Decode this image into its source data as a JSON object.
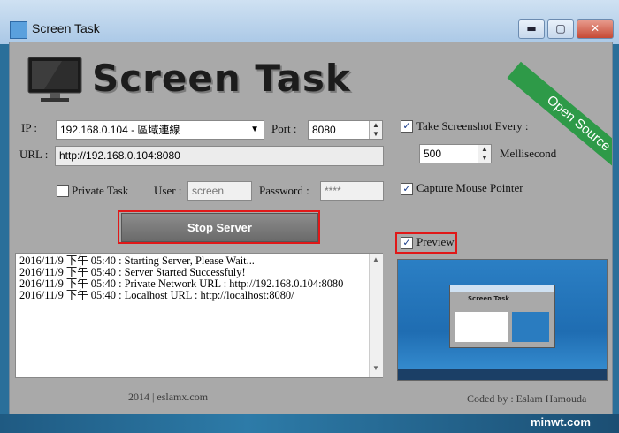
{
  "window": {
    "title": "Screen Task",
    "min_glyph": "▬",
    "max_glyph": "▢",
    "close_glyph": "✕"
  },
  "header": {
    "brand": "Screen Task",
    "ribbon": "Open Source"
  },
  "form": {
    "ip_label": "IP :",
    "ip_value": "192.168.0.104 - 區域連線",
    "port_label": "Port :",
    "port_value": "8080",
    "url_label": "URL :",
    "url_value": "http://192.168.0.104:8080",
    "private_task_label": "Private Task",
    "private_task_checked": false,
    "user_label": "User :",
    "user_placeholder": "screen",
    "password_label": "Password :",
    "password_value": "****"
  },
  "actions": {
    "stop_server": "Stop Server"
  },
  "options": {
    "take_screenshot_label": "Take Screenshot Every :",
    "take_screenshot_checked": true,
    "interval_value": "500",
    "interval_unit": "Mellisecond",
    "capture_mouse_label": "Capture Mouse Pointer",
    "capture_mouse_checked": true,
    "preview_label": "Preview",
    "preview_checked": true
  },
  "log": [
    "2016/11/9 下午 05:40 : Starting Server, Please Wait...",
    "2016/11/9 下午 05:40 : Server Started Successfuly!",
    "2016/11/9 下午 05:40 : Private Network URL : http://192.168.0.104:8080",
    "2016/11/9 下午 05:40 : Localhost URL : http://localhost:8080/"
  ],
  "footer": {
    "left": "2014 | eslamx.com",
    "right": "Coded by : Eslam Hamouda"
  },
  "watermark": "minwt.com",
  "icons": {
    "app": "screen-task-app-icon",
    "monitor": "monitor-icon",
    "dropdown": "chevron-down-icon",
    "spin_up": "▲",
    "spin_down": "▼",
    "check": "✓"
  },
  "colors": {
    "highlight": "#e01818",
    "ribbon": "#2e9a48",
    "panel": "#a9a9a9"
  }
}
